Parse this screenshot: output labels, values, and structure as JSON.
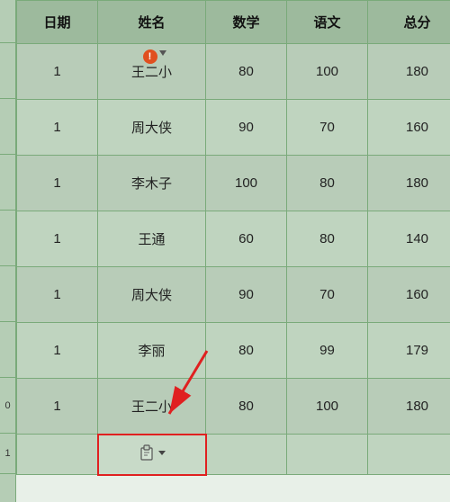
{
  "table": {
    "headers": [
      "日期",
      "姓名",
      "数学",
      "语文",
      "总分"
    ],
    "rows": [
      {
        "date": "1",
        "name": "王二小",
        "math": "80",
        "chinese": "100",
        "total": "180"
      },
      {
        "date": "1",
        "name": "周大侠",
        "math": "90",
        "chinese": "70",
        "total": "160"
      },
      {
        "date": "1",
        "name": "李木子",
        "math": "100",
        "chinese": "80",
        "total": "180"
      },
      {
        "date": "1",
        "name": "王通",
        "math": "60",
        "chinese": "80",
        "total": "140"
      },
      {
        "date": "1",
        "name": "周大侠",
        "math": "90",
        "chinese": "70",
        "total": "160"
      },
      {
        "date": "1",
        "name": "李丽",
        "math": "80",
        "chinese": "99",
        "total": "179"
      },
      {
        "date": "1",
        "name": "王二小",
        "math": "80",
        "chinese": "100",
        "total": "180"
      }
    ],
    "bottom_row_left": "0",
    "paste_label": "粘贴"
  },
  "colors": {
    "border": "#7aaa7a",
    "header_bg": "#9dba9d",
    "cell_bg_odd": "#b8ccb8",
    "cell_bg_even": "#bfd4bf",
    "warning": "#e05020",
    "arrow_red": "#e02020",
    "paste_border": "#e02020"
  }
}
